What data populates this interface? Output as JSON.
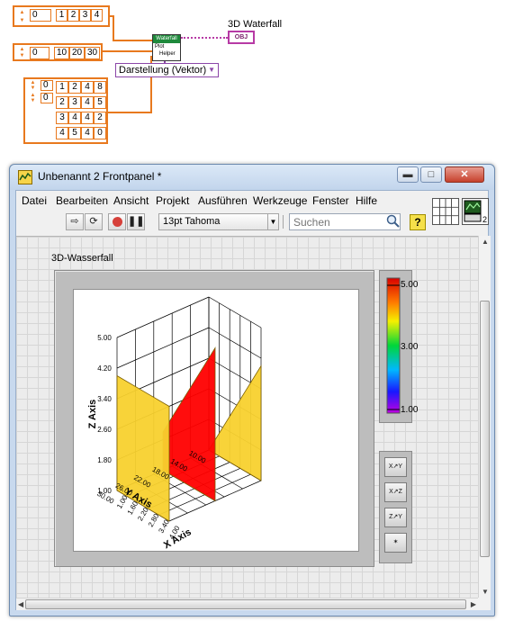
{
  "block_diagram": {
    "array1": {
      "index": "0",
      "values": [
        "1",
        "2",
        "3",
        "4"
      ]
    },
    "array2": {
      "index": "0",
      "values": [
        "10",
        "20",
        "30"
      ]
    },
    "array3": {
      "indices": [
        "0",
        "0"
      ],
      "rows": [
        [
          "1",
          "2",
          "4",
          "8"
        ],
        [
          "2",
          "3",
          "4",
          "5"
        ],
        [
          "3",
          "4",
          "4",
          "2"
        ],
        [
          "4",
          "5",
          "4",
          "0"
        ]
      ]
    },
    "helper_vi": {
      "title": "Waterfall",
      "lines": [
        "Plot",
        "Helper"
      ]
    },
    "indicator": {
      "label": "3D Waterfall",
      "terminal": "OBJ"
    },
    "ring_constant": "Darstellung (Vektor)",
    "colors": {
      "numeric_wire": "#e8791e",
      "object_wire": "#b73aa5",
      "ring_wire": "#8b46a8"
    }
  },
  "window": {
    "title": "Unbenannt 2 Frontpanel *",
    "menu": [
      "Datei",
      "Bearbeiten",
      "Ansicht",
      "Projekt",
      "Ausführen",
      "Werkzeuge",
      "Fenster",
      "Hilfe"
    ],
    "toolbar": {
      "font": "13pt Tahoma",
      "search_placeholder": "Suchen",
      "help": "?"
    },
    "connector_count": "2"
  },
  "graph": {
    "label": "3D-Wasserfall",
    "x_axis": {
      "title": "X Axis",
      "ticks": [
        "1.00",
        "1.60",
        "2.20",
        "2.80",
        "3.40",
        "4.00"
      ]
    },
    "y_axis": {
      "title": "Y Axis",
      "ticks": [
        "10.00",
        "14.00",
        "18.00",
        "22.00",
        "26.00",
        "30.00"
      ]
    },
    "z_axis": {
      "title": "Z Axis",
      "ticks": [
        "1.00",
        "1.80",
        "2.60",
        "3.40",
        "4.20",
        "5.00"
      ]
    },
    "colors": {
      "slice_yellow": "#f8d12e",
      "slice_red": "#ff0000",
      "frame": "#bdbdbd"
    }
  },
  "legend": {
    "ticks": [
      "5.00",
      "3.00",
      "1.00"
    ]
  },
  "chart_data": {
    "type": "area",
    "title": "3D-Wasserfall",
    "xlabel": "X Axis",
    "ylabel": "Y Axis",
    "zlabel": "Z Axis",
    "x": [
      1,
      2,
      3,
      4
    ],
    "y": [
      10,
      20,
      30
    ],
    "z": [
      [
        1,
        2,
        4,
        8
      ],
      [
        2,
        3,
        4,
        5
      ],
      [
        3,
        4,
        4,
        2
      ],
      [
        4,
        5,
        4,
        0
      ]
    ],
    "xlim": [
      1,
      4
    ],
    "ylim": [
      10,
      30
    ],
    "zlim": [
      1,
      5
    ],
    "colorscale": [
      1,
      5
    ]
  }
}
